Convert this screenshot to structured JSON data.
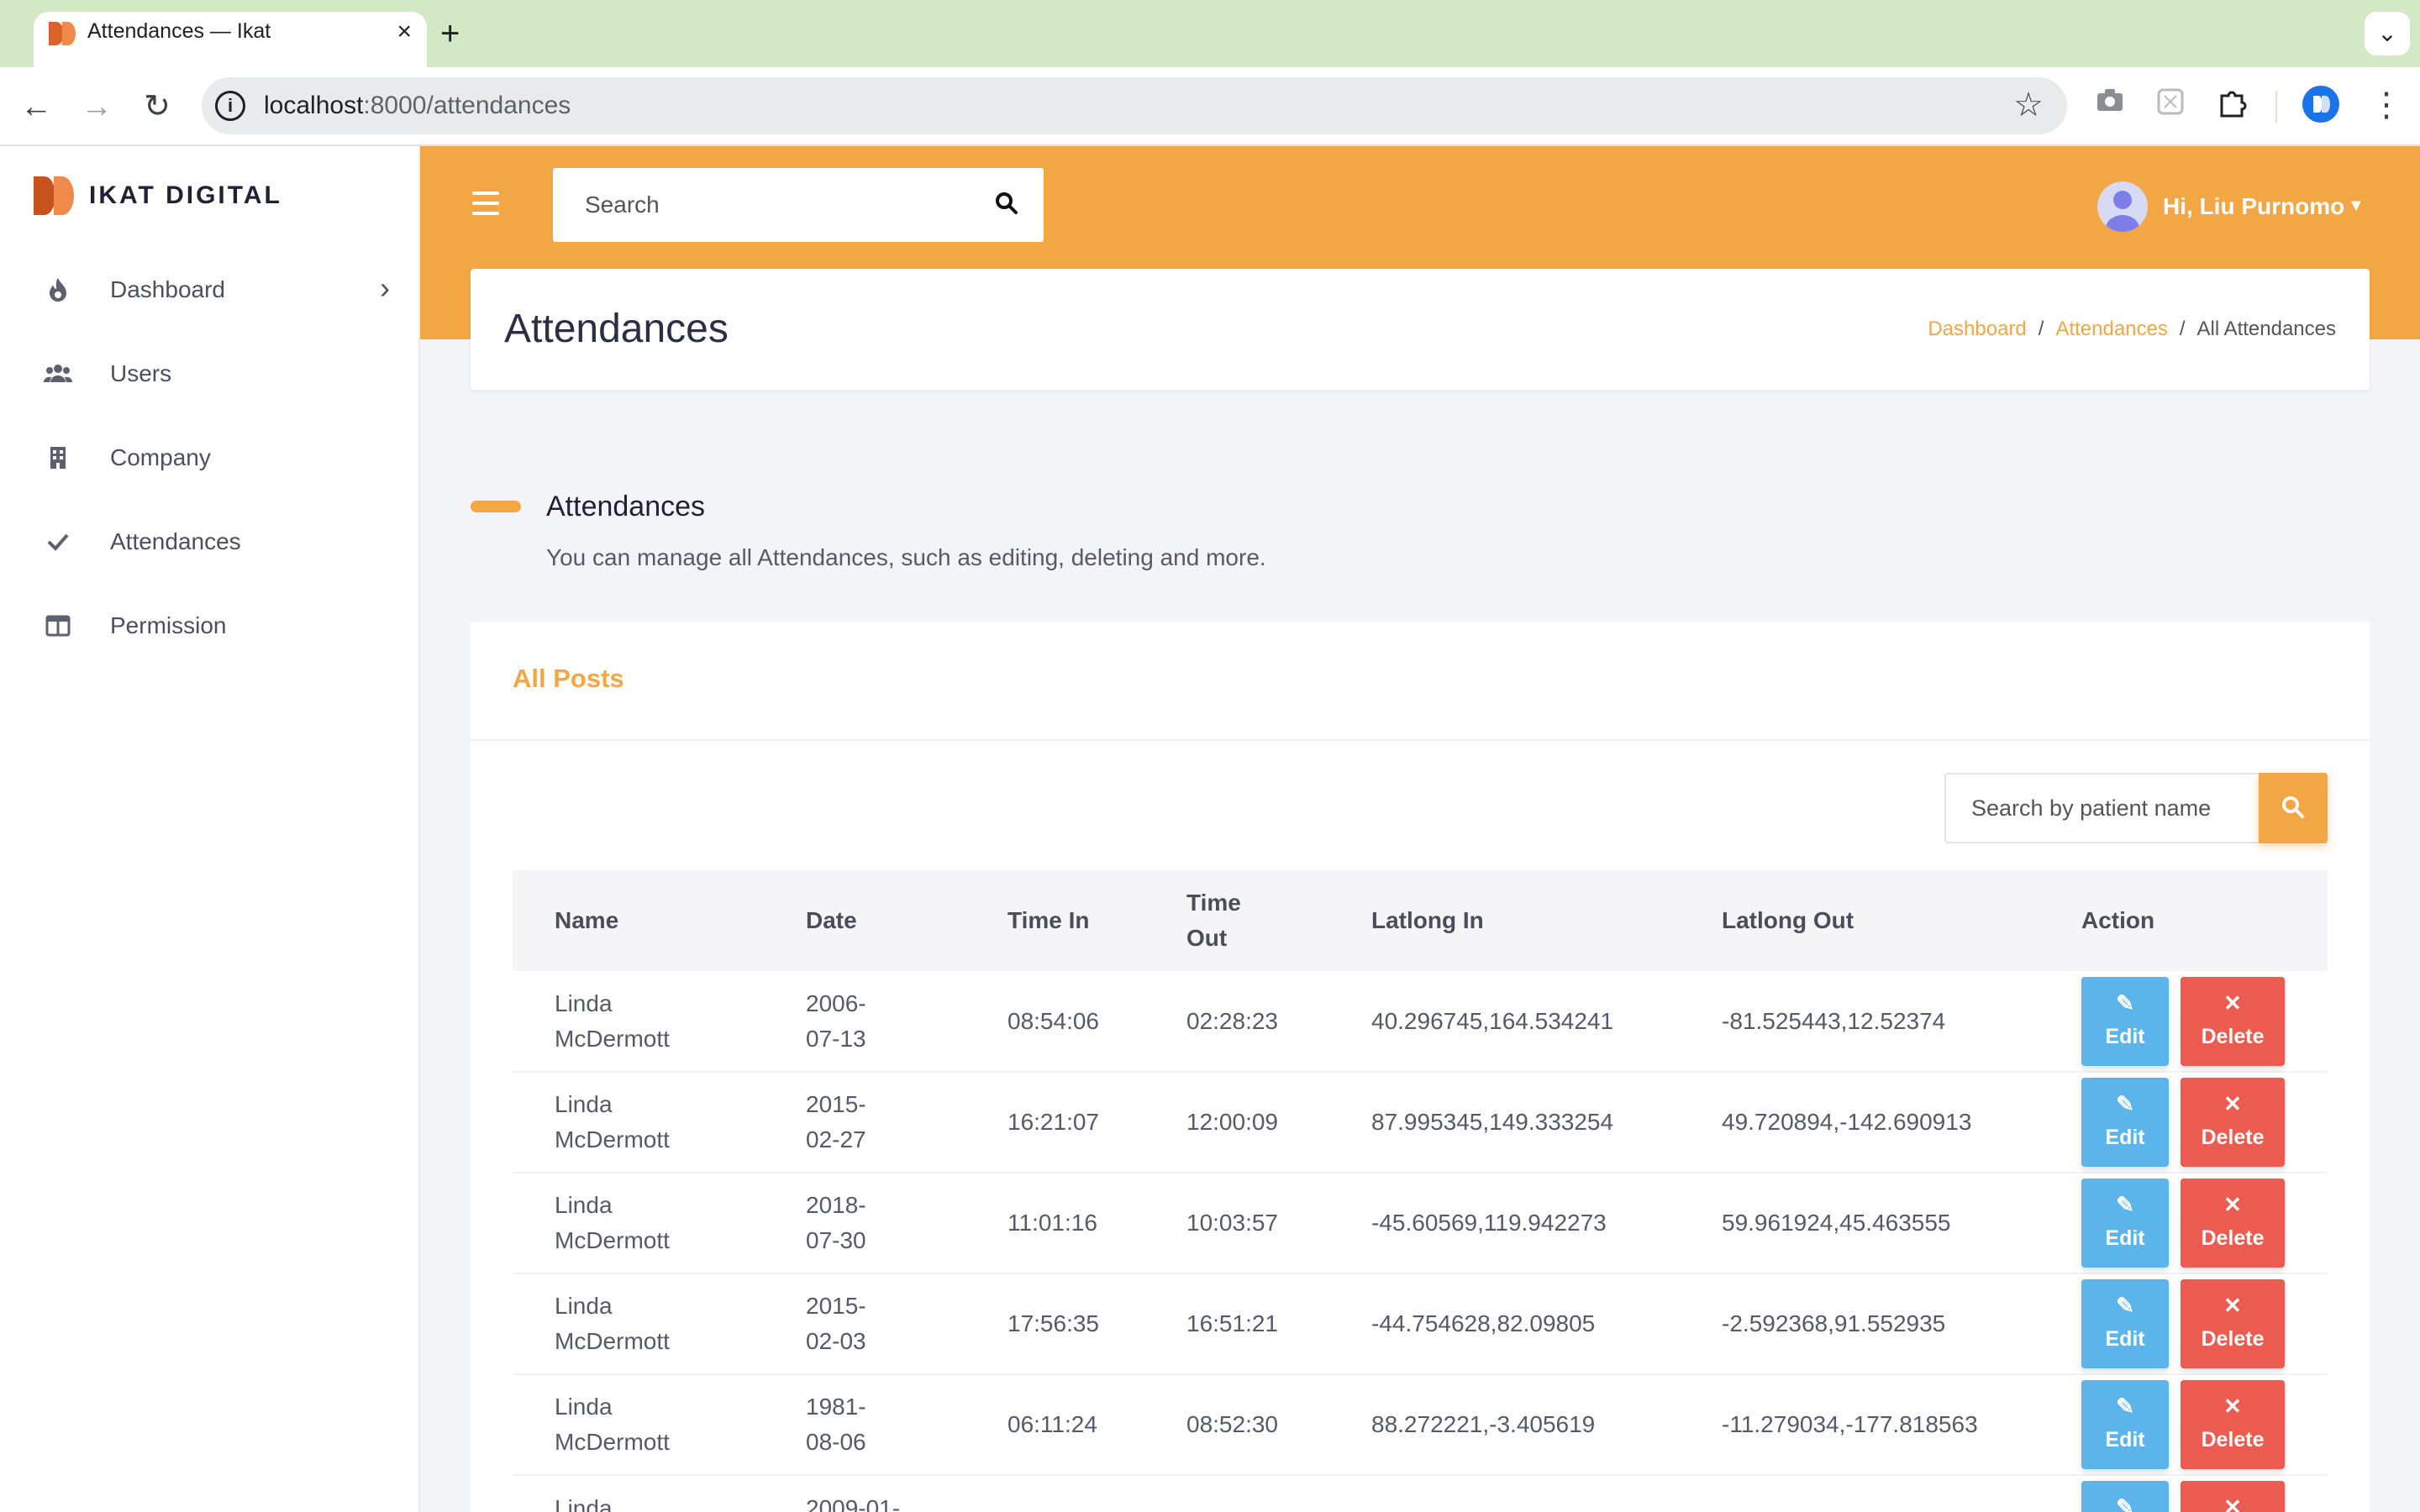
{
  "browser": {
    "tab_title": "Attendances — Ikat",
    "url_host": "localhost",
    "url_path": ":8000/attendances"
  },
  "brand": {
    "name": "IKAT DIGITAL"
  },
  "sidebar": {
    "items": [
      {
        "label": "Dashboard",
        "icon": "fire-icon"
      },
      {
        "label": "Users",
        "icon": "users-icon"
      },
      {
        "label": "Company",
        "icon": "building-icon"
      },
      {
        "label": "Attendances",
        "icon": "check-icon"
      },
      {
        "label": "Permission",
        "icon": "columns-icon"
      }
    ]
  },
  "header": {
    "search_placeholder": "Search",
    "user_greeting": "Hi, Liu Purnomo"
  },
  "page": {
    "title": "Attendances",
    "breadcrumb": [
      "Dashboard",
      "Attendances",
      "All Attendances"
    ]
  },
  "section": {
    "title": "Attendances",
    "description": "You can manage all Attendances, such as editing, deleting and more."
  },
  "card": {
    "title": "All Posts",
    "search_placeholder": "Search by patient name"
  },
  "table": {
    "columns": [
      "Name",
      "Date",
      "Time In",
      "Time Out",
      "Latlong In",
      "Latlong Out",
      "Action"
    ],
    "rows": [
      {
        "name": "Linda McDermott",
        "date": "2006-07-13",
        "time_in": "08:54:06",
        "time_out": "02:28:23",
        "latlong_in": "40.296745,164.534241",
        "latlong_out": "-81.525443,12.52374"
      },
      {
        "name": "Linda McDermott",
        "date": "2015-02-27",
        "time_in": "16:21:07",
        "time_out": "12:00:09",
        "latlong_in": "87.995345,149.333254",
        "latlong_out": "49.720894,-142.690913"
      },
      {
        "name": "Linda McDermott",
        "date": "2018-07-30",
        "time_in": "11:01:16",
        "time_out": "10:03:57",
        "latlong_in": "-45.60569,119.942273",
        "latlong_out": "59.961924,45.463555"
      },
      {
        "name": "Linda McDermott",
        "date": "2015-02-03",
        "time_in": "17:56:35",
        "time_out": "16:51:21",
        "latlong_in": "-44.754628,82.09805",
        "latlong_out": "-2.592368,91.552935"
      },
      {
        "name": "Linda McDermott",
        "date": "1981-08-06",
        "time_in": "06:11:24",
        "time_out": "08:52:30",
        "latlong_in": "88.272221,-3.405619",
        "latlong_out": "-11.279034,-177.818563"
      },
      {
        "name": "Linda",
        "date": "2009-01-",
        "time_in": "",
        "time_out": "",
        "latlong_in": "",
        "latlong_out": ""
      }
    ],
    "edit_label": "Edit",
    "delete_label": "Delete"
  },
  "colors": {
    "accent": "#f2a744",
    "edit": "#5bb5ea",
    "delete": "#ec5b4f",
    "brand": "#d9632a"
  }
}
